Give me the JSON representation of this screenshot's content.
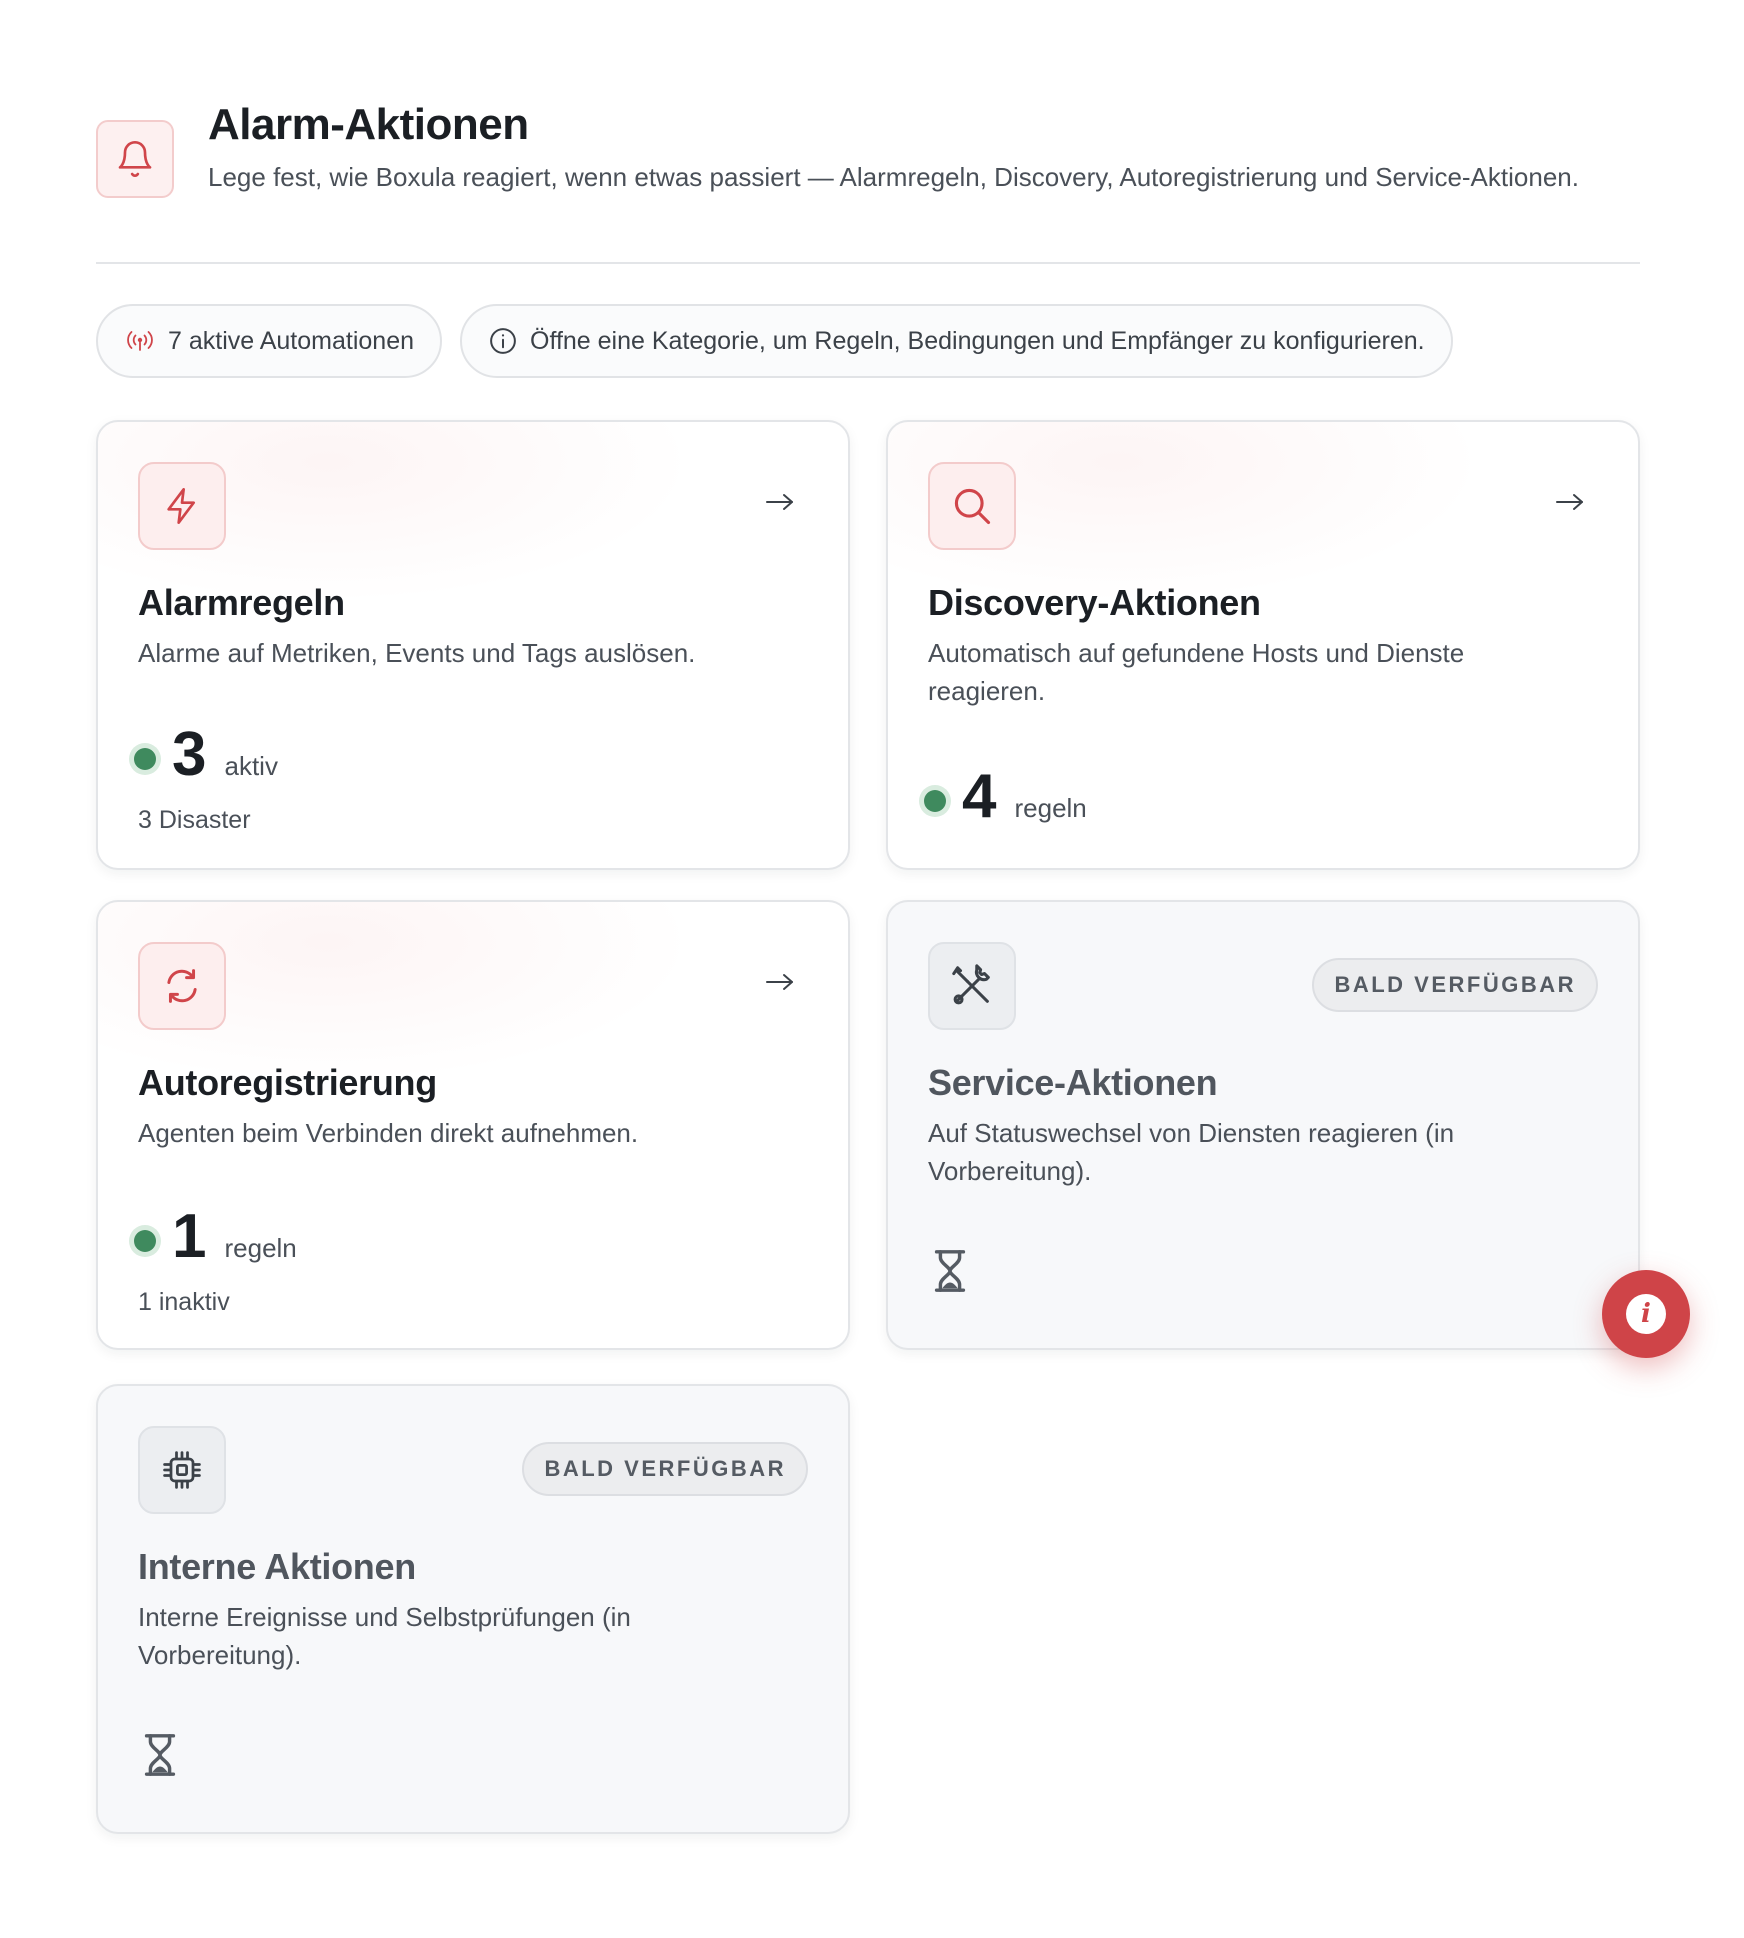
{
  "header": {
    "title": "Alarm-Aktionen",
    "subtitle": "Lege fest, wie Boxula reagiert, wenn etwas passiert — Alarmregeln, Discovery, Autoregistrierung und Service-Aktionen.",
    "icon": "bell-icon"
  },
  "pills": {
    "active_automations": "7 aktive Automationen",
    "hint": "Öffne eine Kategorie, um Regeln, Bedingungen und Empfänger zu konfigurieren."
  },
  "cards": [
    {
      "title": "Alarmregeln",
      "description": "Alarme auf Metriken, Events und Tags auslösen.",
      "count": "3",
      "unit": "aktiv",
      "sub": "3 Disaster",
      "icon": "lightning-icon"
    },
    {
      "title": "Discovery-Aktionen",
      "description": "Automatisch auf gefundene Hosts und Dienste reagieren.",
      "count": "4",
      "unit": "regeln",
      "icon": "search-icon"
    },
    {
      "title": "Autoregistrierung",
      "description": "Agenten beim Verbinden direkt aufnehmen.",
      "count": "1",
      "unit": "regeln",
      "sub": "1 inaktiv",
      "icon": "refresh-icon"
    },
    {
      "title": "Service-Aktionen",
      "description": "Auf Statuswechsel von Diensten reagieren (in Vorbereitung).",
      "badge": "BALD VERFÜGBAR",
      "icon": "tools-icon"
    },
    {
      "title": "Interne Aktionen",
      "description": "Interne Ereignisse und Selbstprüfungen (in Vorbereitung).",
      "badge": "BALD VERFÜGBAR",
      "icon": "chip-icon"
    }
  ],
  "colors": {
    "accent": "#cf4448",
    "status_green": "#3f8a5e",
    "muted_text": "#4a5058"
  }
}
